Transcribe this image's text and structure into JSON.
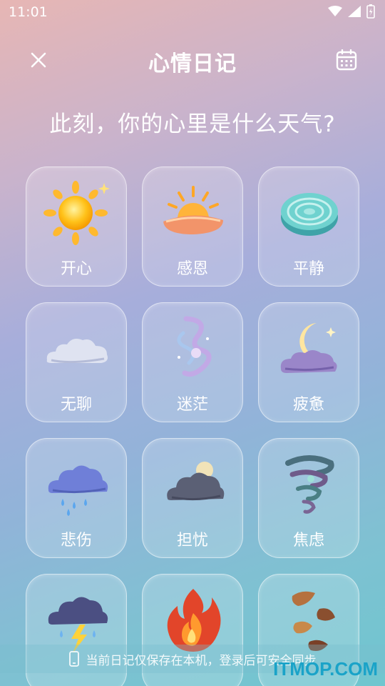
{
  "status_bar": {
    "time": "11:01"
  },
  "header": {
    "title": "心情日记"
  },
  "prompt": "此刻，你的心里是什么天气?",
  "moods": [
    {
      "label": "开心",
      "icon": "sun-icon"
    },
    {
      "label": "感恩",
      "icon": "sunrise-icon"
    },
    {
      "label": "平静",
      "icon": "calm-pool-icon"
    },
    {
      "label": "无聊",
      "icon": "flat-cloud-icon"
    },
    {
      "label": "迷茫",
      "icon": "swirl-wind-icon"
    },
    {
      "label": "疲惫",
      "icon": "moon-cloud-icon"
    },
    {
      "label": "悲伤",
      "icon": "rain-cloud-icon"
    },
    {
      "label": "担忧",
      "icon": "overcast-icon"
    },
    {
      "label": "焦虑",
      "icon": "tornado-icon"
    },
    {
      "label": "",
      "icon": "thunderstorm-icon"
    },
    {
      "label": "",
      "icon": "fire-icon"
    },
    {
      "label": "",
      "icon": "falling-leaves-icon"
    }
  ],
  "footer": {
    "note": "当前日记仅保存在本机，登录后可安全同步"
  },
  "watermark": "ITMOP.COM"
}
